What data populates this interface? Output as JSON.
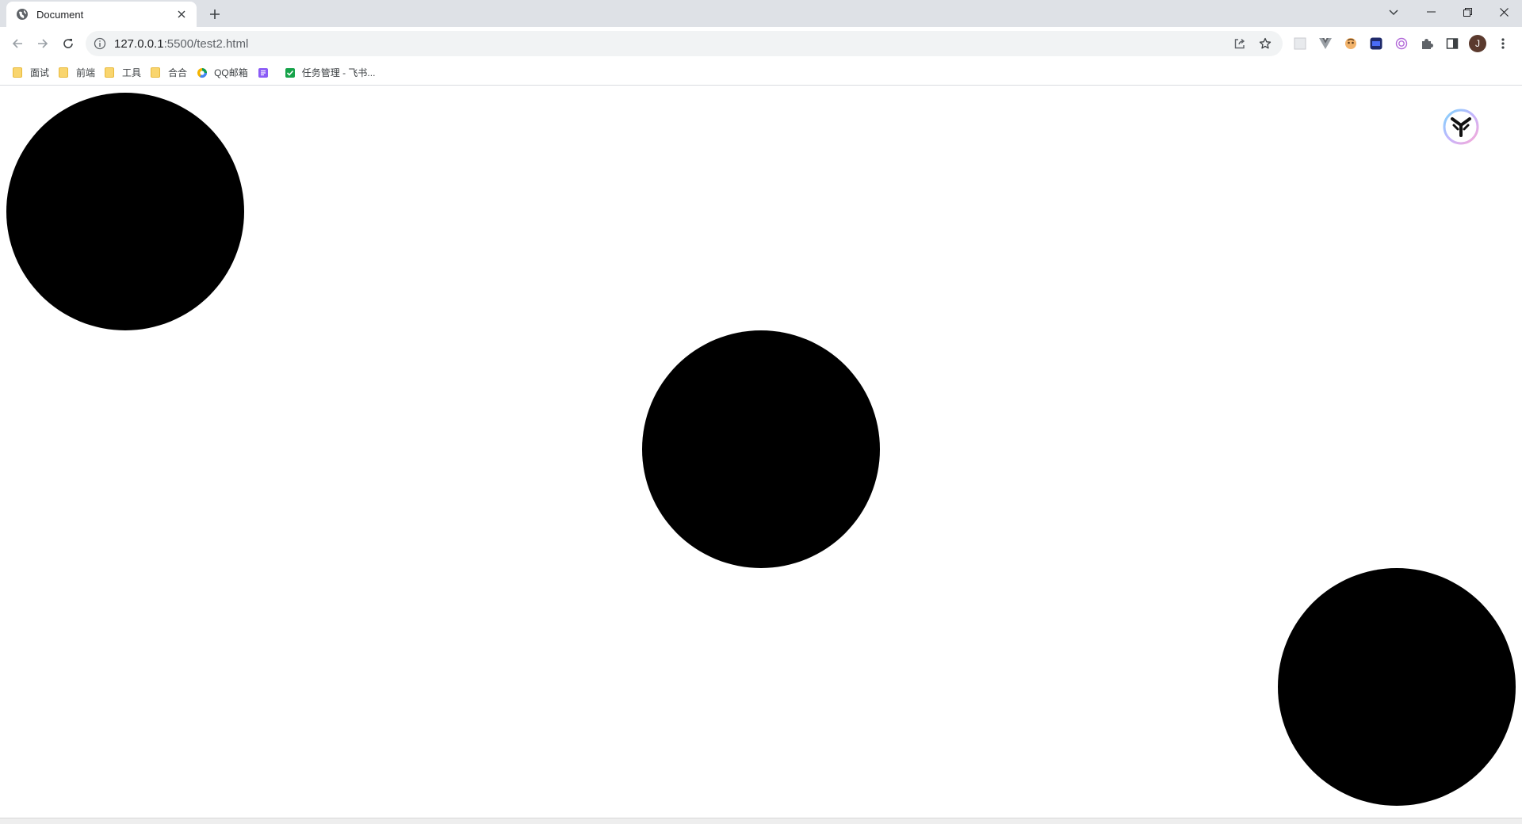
{
  "browser": {
    "tab": {
      "title": "Document",
      "icon": "globe-icon"
    },
    "address": {
      "host": "127.0.0.1",
      "path": ":5500/test2.html"
    },
    "profile_initial": "J",
    "extensions": [
      "extension-grid-icon",
      "vue-devtools-icon",
      "extension-face-icon",
      "extension-m-icon",
      "openai-icon",
      "puzzle-icon"
    ]
  },
  "bookmarks": [
    {
      "label": "面试",
      "icon": "folder-icon"
    },
    {
      "label": "前端",
      "icon": "folder-icon"
    },
    {
      "label": "工具",
      "icon": "folder-icon"
    },
    {
      "label": "合合",
      "icon": "folder-icon"
    },
    {
      "label": "QQ邮箱",
      "icon": "qq-mail-icon"
    },
    {
      "label": "",
      "icon": "notes-icon"
    },
    {
      "label": "任务管理 - 飞书...",
      "icon": "task-check-icon"
    }
  ],
  "content": {
    "circle_color": "#000000",
    "floating_widget_icon": "y-logo-icon"
  },
  "colors": {
    "tabstrip": "#dee1e6",
    "omnibox": "#f1f3f4",
    "folder": "#f9d56e"
  }
}
